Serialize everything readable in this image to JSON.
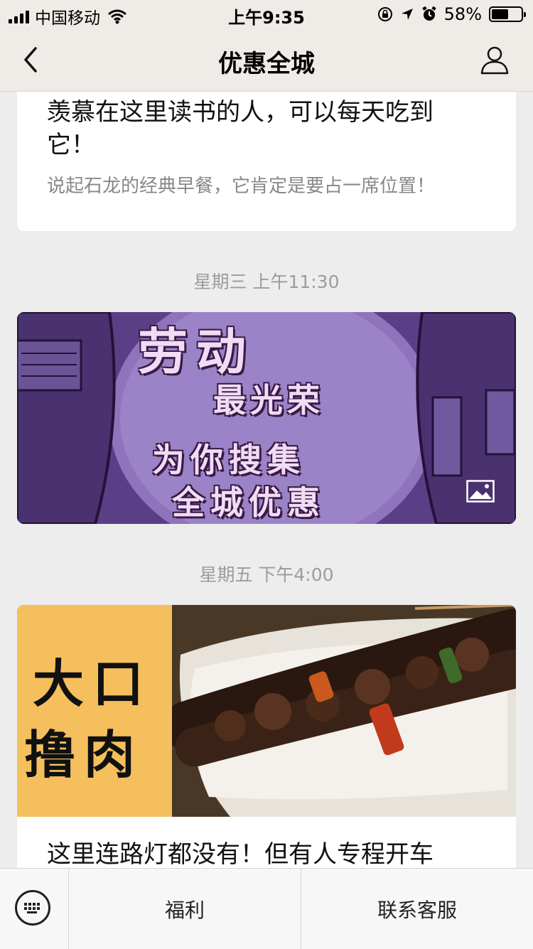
{
  "status_bar": {
    "carrier": "中国移动",
    "time": "上午9:35",
    "battery_percent": "58%",
    "battery_level": 0.58
  },
  "nav": {
    "title": "优惠全城"
  },
  "articles": [
    {
      "title": "羡慕在这里读书的人，可以每天吃到它！",
      "summary": "说起石龙的经典早餐，它肯定是要占一席位置！"
    },
    {
      "timestamp": "星期三 上午11:30",
      "image_lines": [
        "劳动",
        "最光荣",
        "为你搜集",
        "全城优惠"
      ]
    },
    {
      "timestamp": "星期五 下午4:00",
      "image_lines": [
        "大口",
        "撸肉"
      ],
      "title": "这里连路灯都没有！但有人专程开车"
    }
  ],
  "bottom_menu": {
    "items": [
      "福利",
      "联系客服"
    ]
  },
  "colors": {
    "bar_bg": "#efebe6",
    "page_bg": "#ededed",
    "banner_purple": "#7b5aa6",
    "banner_yellow": "#f5bf5d"
  }
}
